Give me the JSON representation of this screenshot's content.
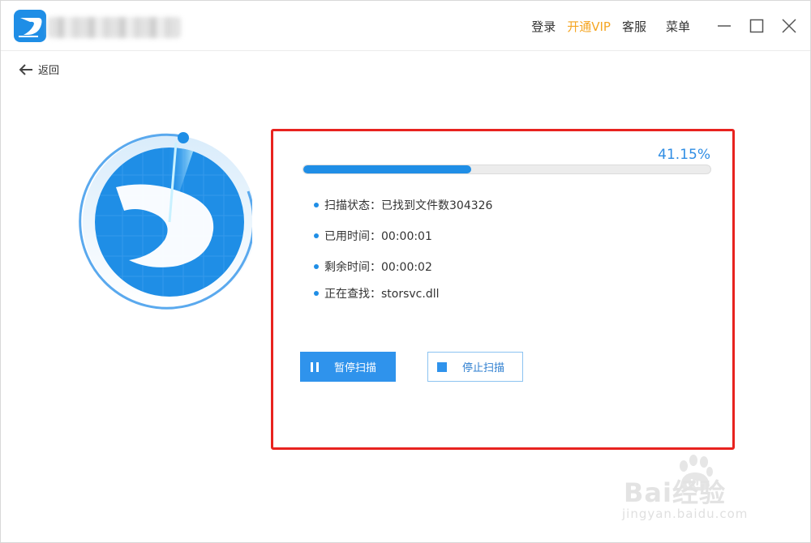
{
  "titlebar": {
    "login": "登录",
    "vip": "开通VIP",
    "support": "客服",
    "menu": "菜单"
  },
  "nav": {
    "back": "返回"
  },
  "scan": {
    "percent_label": "41.15%",
    "progress": 0.4115,
    "status_label": "扫描状态：已找到文件数304326",
    "elapsed_label": "已用时间：00:00:01",
    "remaining_label": "剩余时间：00:00:02",
    "current_label": "正在查找：storsvc.dll"
  },
  "buttons": {
    "pause": "暂停扫描",
    "stop": "停止扫描"
  },
  "watermark": {
    "brand": "Bai经验",
    "paw_text": "du",
    "url": "jingyan.baidu.com"
  },
  "colors": {
    "accent": "#1f8ee6",
    "vip": "#f5a623",
    "highlight_border": "#e8231f"
  }
}
